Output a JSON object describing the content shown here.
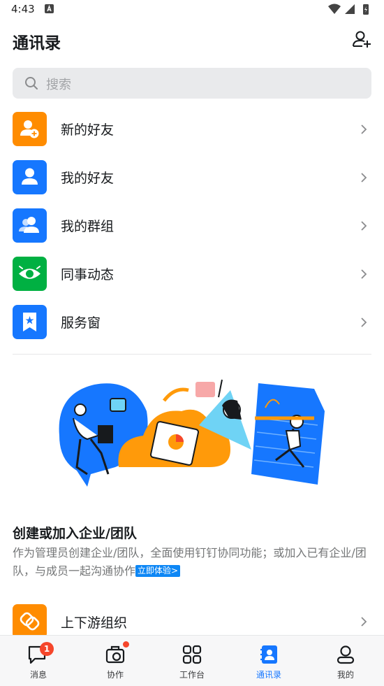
{
  "status_bar": {
    "time": "4:43"
  },
  "header": {
    "title": "通讯录"
  },
  "search": {
    "placeholder": "搜索"
  },
  "menu": [
    {
      "label": "新的好友",
      "icon": "add-user-icon",
      "color": "#ff8c00"
    },
    {
      "label": "我的好友",
      "icon": "user-icon",
      "color": "#1677ff"
    },
    {
      "label": "我的群组",
      "icon": "group-icon",
      "color": "#1677ff"
    },
    {
      "label": "同事动态",
      "icon": "eye-icon",
      "color": "#00b042"
    },
    {
      "label": "服务窗",
      "icon": "bookmark-star-icon",
      "color": "#1677ff"
    }
  ],
  "promo": {
    "title": "创建或加入企业/团队",
    "description": "作为管理员创建企业/团队，全面使用钉钉协同功能；或加入已有企业/团队，与成员一起沟通协作",
    "link_label": "立即体验>"
  },
  "upstream": {
    "label": "上下游组织",
    "icon": "link-icon",
    "color": "#ff8c00"
  },
  "tabs": [
    {
      "label": "消息",
      "icon": "chat-icon",
      "badge": "1"
    },
    {
      "label": "协作",
      "icon": "briefcase-icon",
      "dot": true
    },
    {
      "label": "工作台",
      "icon": "grid-icon"
    },
    {
      "label": "通讯录",
      "icon": "contacts-icon",
      "active": true
    },
    {
      "label": "我的",
      "icon": "profile-icon"
    }
  ],
  "colors": {
    "accent": "#1677ff",
    "orange": "#ff8c00",
    "green": "#00b042",
    "badge": "#f5462b"
  }
}
